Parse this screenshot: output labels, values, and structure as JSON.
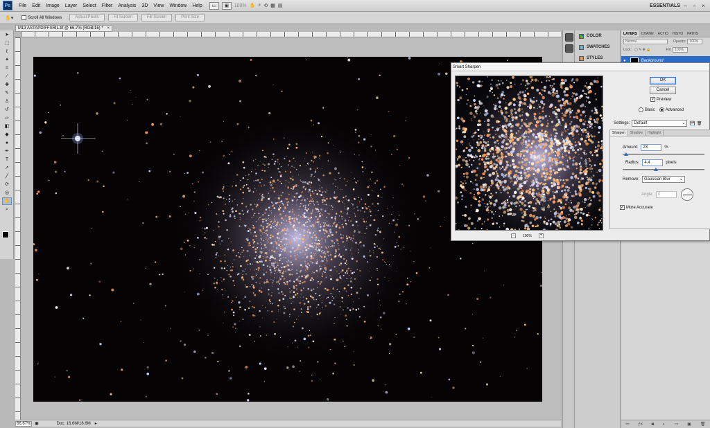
{
  "app": {
    "logo": "Ps",
    "workspace": "ESSENTIALS"
  },
  "menu": [
    "File",
    "Edit",
    "Image",
    "Layer",
    "Select",
    "Filter",
    "Analysis",
    "3D",
    "View",
    "Window",
    "Help"
  ],
  "app_bar": {
    "zoom": "100%"
  },
  "options_bar": {
    "scroll_all_windows": "Scroll All Windows",
    "buttons": [
      "Actual Pixels",
      "Fit Screen",
      "Fill Screen",
      "Print Size"
    ]
  },
  "document": {
    "tab_title": "M13 ASTAPDIFFSRIL.tif @ 66.7% (RGB/16) *",
    "tab_close": "×",
    "status_zoom": "66.67%",
    "status_doc": "Doc: 16.6M/16.6M"
  },
  "panels": {
    "color": "COLOR",
    "swatches": "SWATCHES",
    "styles": "STYLES"
  },
  "layers": {
    "tabs": [
      "LAYERS",
      "CHANN",
      "ACTIO",
      "HISTO",
      "PATHS"
    ],
    "blend_mode": "Normal",
    "opacity_label": "Opacity:",
    "opacity": "100%",
    "lock_label": "Lock:",
    "fill_label": "Fill:",
    "fill": "100%",
    "layer_name": "Background"
  },
  "dialog": {
    "title": "Smart Sharpen",
    "ok": "OK",
    "cancel": "Cancel",
    "preview": "Preview",
    "basic": "Basic",
    "advanced": "Advanced",
    "settings_label": "Settings:",
    "settings_value": "Default",
    "tabs": [
      "Sharpen",
      "Shadow",
      "Highlight"
    ],
    "amount_label": "Amount:",
    "amount": "23",
    "amount_unit": "%",
    "amount_fraction": 0.046,
    "radius_label": "Radius:",
    "radius": "4.4",
    "radius_unit": "pixels",
    "radius_fraction": 0.41,
    "remove_label": "Remove:",
    "remove_value": "Gaussian Blur",
    "angle_label": "Angle:",
    "angle": "0",
    "more_accurate": "More Accurate",
    "preview_zoom": "100%"
  }
}
